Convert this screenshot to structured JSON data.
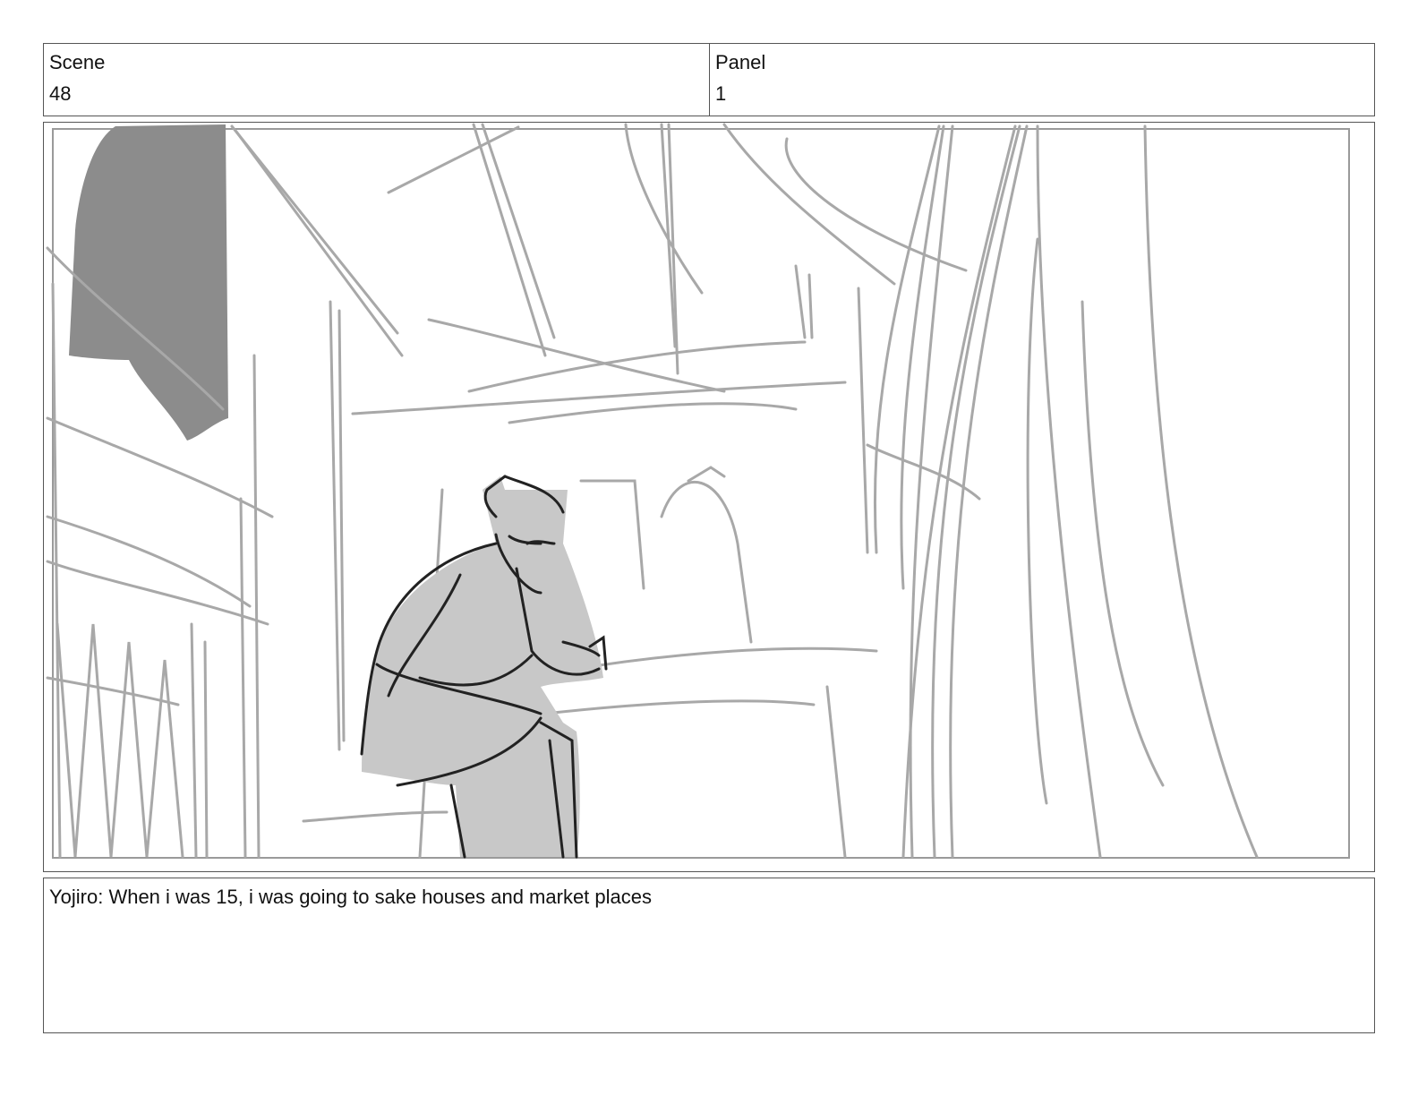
{
  "header": {
    "scene_label": "Scene",
    "scene_value": "48",
    "panel_label": "Panel",
    "panel_value": "1"
  },
  "panel_image": {
    "subject": "sketch-seated-figure",
    "palette": {
      "line_light": "#a8a8a8",
      "line_mid": "#8a8a8a",
      "line_dark": "#222222",
      "fill_light": "#c8c8c8",
      "fill_dark": "#8c8c8c"
    }
  },
  "caption": {
    "text": "Yojiro: When i was 15, i was going to sake houses and market places"
  }
}
